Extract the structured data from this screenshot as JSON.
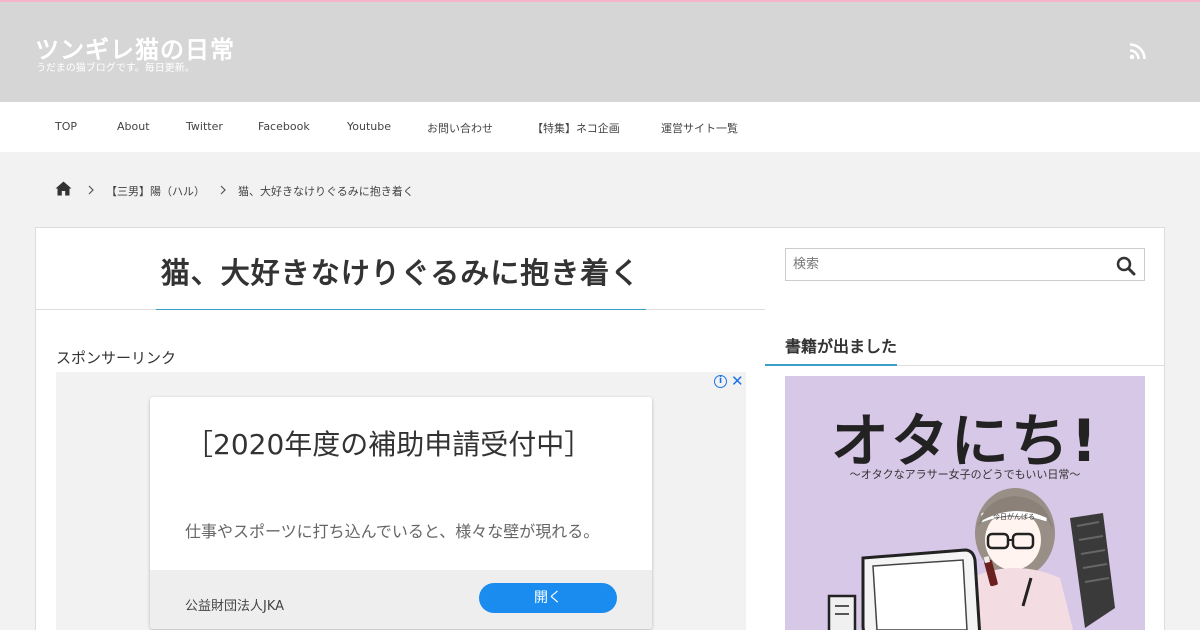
{
  "header": {
    "site_title": "ツンギレ猫の日常",
    "site_description": "うだまの猫ブログです。毎日更新。",
    "rss_icon": "rss-icon",
    "background_color": "#d6d6d6",
    "accent_line_color": "#f5b5c8"
  },
  "nav": {
    "items": [
      "TOP",
      "About",
      "Twitter",
      "Facebook",
      "Youtube",
      "お問い合わせ",
      "【特集】ネコ企画",
      "運営サイト一覧"
    ]
  },
  "breadcrumb": {
    "home_icon": "home-icon",
    "items": [
      "【三男】陽（ハル）",
      "猫、大好きなけりぐるみに抱き着く"
    ]
  },
  "post": {
    "title": "猫、大好きなけりぐるみに抱き着く",
    "sponsor_label": "スポンサーリンク",
    "accent_color": "#3aa0c8"
  },
  "ad": {
    "headline": "［2020年度の補助申請受付中］",
    "body": "仕事やスポーツに打ち込んでいると、様々な壁が現れる。",
    "advertiser": "公益財団法人JKA",
    "cta": "開く",
    "info_symbol": "i",
    "close_symbol": "✕",
    "cta_color": "#1a8cf0"
  },
  "sidebar": {
    "search_placeholder": "検索",
    "search_icon": "search-icon",
    "widget_title": "書籍が出ました",
    "book": {
      "title": "オタにち!",
      "subtitle": "〜オタクなアラサー女子のどうでもいい日常〜",
      "headband_text": "今日がんばる",
      "background_color": "#d8c8e8"
    }
  }
}
